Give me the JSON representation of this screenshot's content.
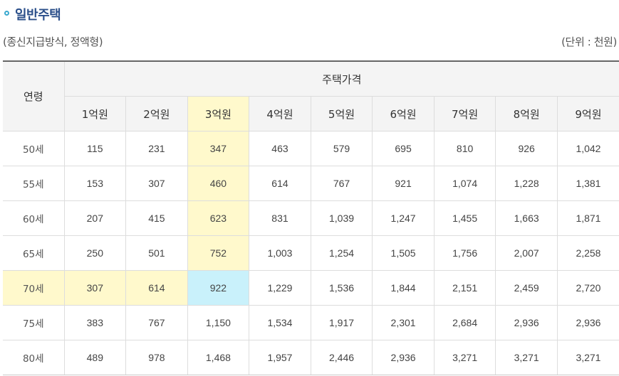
{
  "section": {
    "title": "일반주택",
    "subtitle": "(종신지급방식, 정액형)",
    "unit_note": "(단위 : 천원)"
  },
  "table": {
    "age_header": "연령",
    "price_header": "주택가격",
    "columns": [
      "1억원",
      "2억원",
      "3억원",
      "4억원",
      "5억원",
      "6억원",
      "7억원",
      "8억원",
      "9억원"
    ],
    "rows": [
      {
        "age": "50세",
        "values": [
          "115",
          "231",
          "347",
          "463",
          "579",
          "695",
          "810",
          "926",
          "1,042"
        ]
      },
      {
        "age": "55세",
        "values": [
          "153",
          "307",
          "460",
          "614",
          "767",
          "921",
          "1,074",
          "1,228",
          "1,381"
        ]
      },
      {
        "age": "60세",
        "values": [
          "207",
          "415",
          "623",
          "831",
          "1,039",
          "1,247",
          "1,455",
          "1,663",
          "1,871"
        ]
      },
      {
        "age": "65세",
        "values": [
          "250",
          "501",
          "752",
          "1,003",
          "1,254",
          "1,505",
          "1,756",
          "2,007",
          "2,258"
        ]
      },
      {
        "age": "70세",
        "values": [
          "307",
          "614",
          "922",
          "1,229",
          "1,536",
          "1,844",
          "2,151",
          "2,459",
          "2,720"
        ]
      },
      {
        "age": "75세",
        "values": [
          "383",
          "767",
          "1,150",
          "1,534",
          "1,917",
          "2,301",
          "2,684",
          "2,936",
          "2,936"
        ]
      },
      {
        "age": "80세",
        "values": [
          "489",
          "978",
          "1,468",
          "1,957",
          "2,446",
          "2,936",
          "3,271",
          "3,271",
          "3,271"
        ]
      }
    ]
  },
  "highlight": {
    "column_index": 2,
    "row_index": 4,
    "line_color": "#fff9cc",
    "intersection_color": "#c9f1fb"
  },
  "colors": {
    "title": "#2b4f8a",
    "bullet": "#3aa9cf",
    "header_bg": "#f4f4f4"
  }
}
